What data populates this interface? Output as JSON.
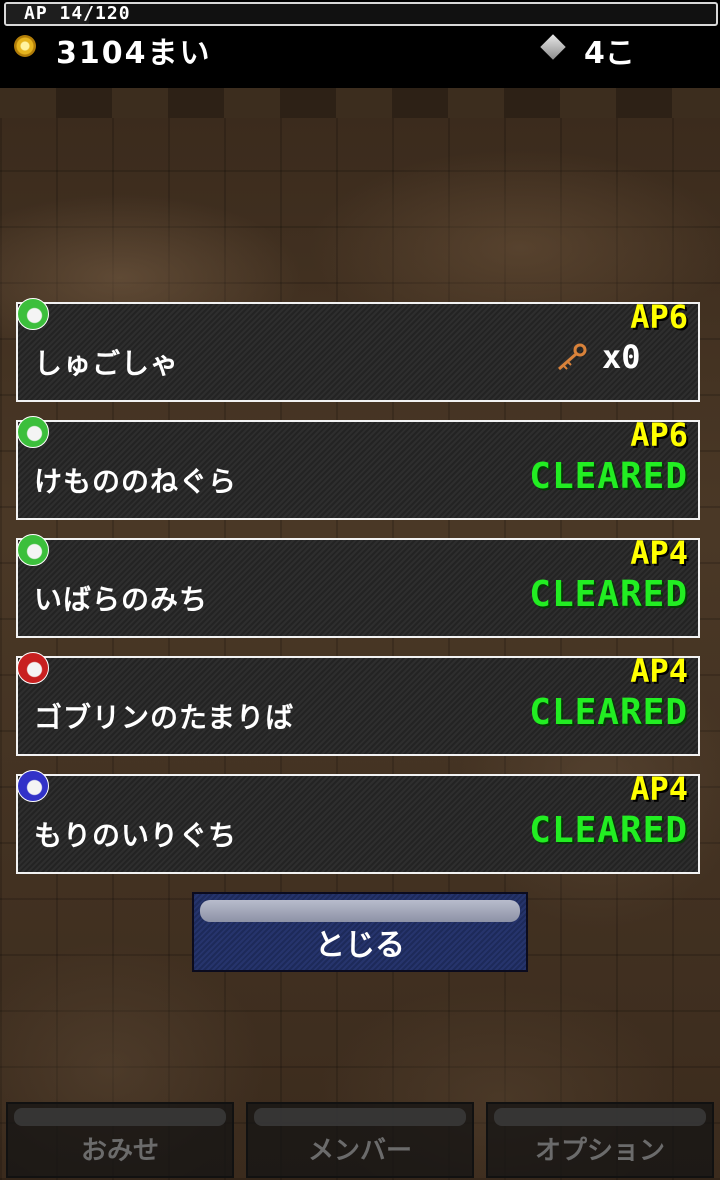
{
  "header": {
    "ap_label": "AP 14/120",
    "ap_fraction": 0.1167,
    "coins": "3104まい",
    "gems": "4こ"
  },
  "stages": [
    {
      "name": "しゅごしゃ",
      "ap": "AP6",
      "orb": "green",
      "reward_count": "x0"
    },
    {
      "name": "けもののねぐら",
      "ap": "AP6",
      "orb": "green",
      "status": "CLEARED"
    },
    {
      "name": "いばらのみち",
      "ap": "AP4",
      "orb": "green",
      "status": "CLEARED"
    },
    {
      "name": "ゴブリンのたまりば",
      "ap": "AP4",
      "orb": "red",
      "status": "CLEARED"
    },
    {
      "name": "もりのいりぐち",
      "ap": "AP4",
      "orb": "blue",
      "status": "CLEARED"
    }
  ],
  "close_label": "とじる",
  "tabs": [
    "おみせ",
    "メンバー",
    "オプション"
  ],
  "colors": {
    "ap_text": "#ffff00",
    "cleared_text": "#22ee22",
    "card_border": "#f2f2f2",
    "close_button": "#1d2a5a"
  }
}
